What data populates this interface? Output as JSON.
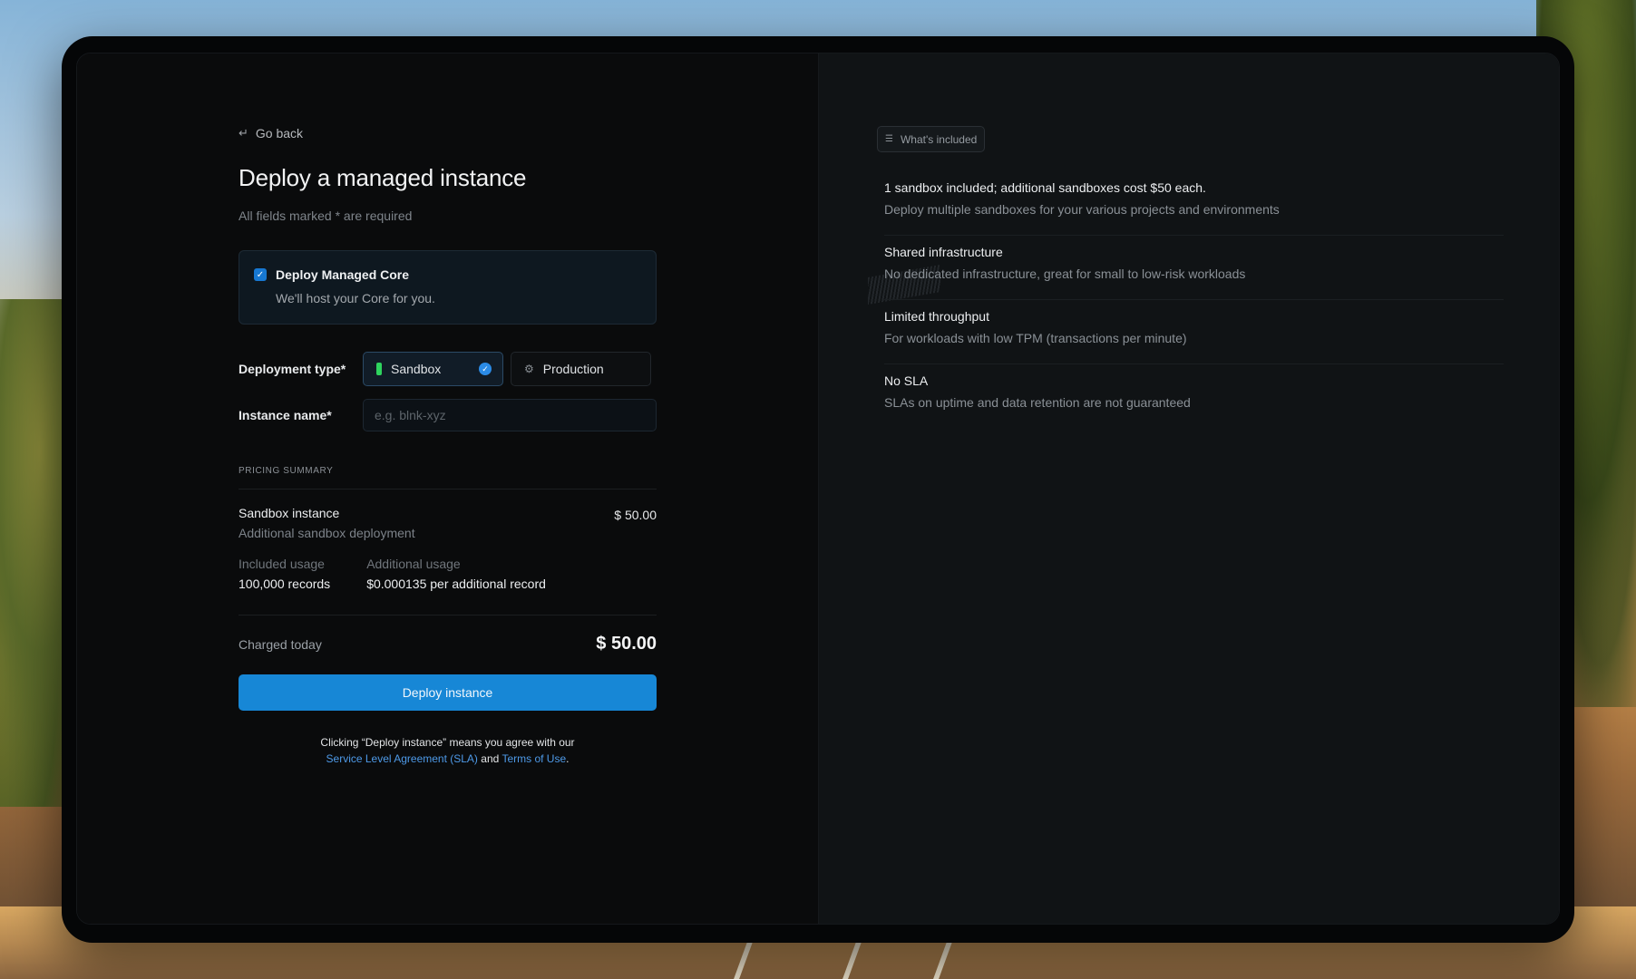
{
  "nav": {
    "go_back": "Go back"
  },
  "page": {
    "title": "Deploy a managed instance",
    "subtitle": "All fields marked * are required"
  },
  "core": {
    "checked": true,
    "title": "Deploy Managed Core",
    "description": "We'll host your Core for you."
  },
  "deployment": {
    "label": "Deployment type*",
    "options": [
      {
        "label": "Sandbox",
        "selected": true
      },
      {
        "label": "Production",
        "selected": false
      }
    ]
  },
  "instance": {
    "label": "Instance name*",
    "value": "",
    "placeholder": "e.g. blnk-xyz"
  },
  "pricing": {
    "heading": "PRICING SUMMARY",
    "item": {
      "title": "Sandbox instance",
      "description": "Additional sandbox deployment",
      "price": "$ 50.00"
    },
    "included": {
      "label": "Included usage",
      "value": "100,000 records"
    },
    "additional": {
      "label": "Additional usage",
      "value": "$0.000135 per additional record"
    },
    "total_label": "Charged today",
    "total_value": "$ 50.00"
  },
  "deploy_button": "Deploy instance",
  "legal": {
    "prefix": "Clicking “Deploy instance” means you agree with our",
    "sla_link": "Service Level Agreement (SLA)",
    "and": "and",
    "terms_link": "Terms of Use",
    "suffix": "."
  },
  "included": {
    "badge": "What's included",
    "items": [
      {
        "title": "1 sandbox included; additional sandboxes cost $50 each.",
        "description": "Deploy multiple sandboxes for your various projects and environments"
      },
      {
        "title": "Shared infrastructure",
        "description": "No dedicated infrastructure, great for small to low-risk workloads"
      },
      {
        "title": "Limited throughput",
        "description": "For workloads with low TPM (transactions per minute)"
      },
      {
        "title": "No SLA",
        "description": "SLAs on uptime and data retention are not guaranteed"
      }
    ]
  },
  "colors": {
    "accent": "#1787d6",
    "sandbox_indicator": "#2ed35e",
    "link": "#4e9ae8"
  },
  "icons": {
    "go_back": "return-arrow-icon",
    "checkbox": "checkmark-icon",
    "sandbox": "sandbox-icon",
    "production": "production-icon",
    "selected": "check-circle-icon",
    "included": "list-icon"
  }
}
